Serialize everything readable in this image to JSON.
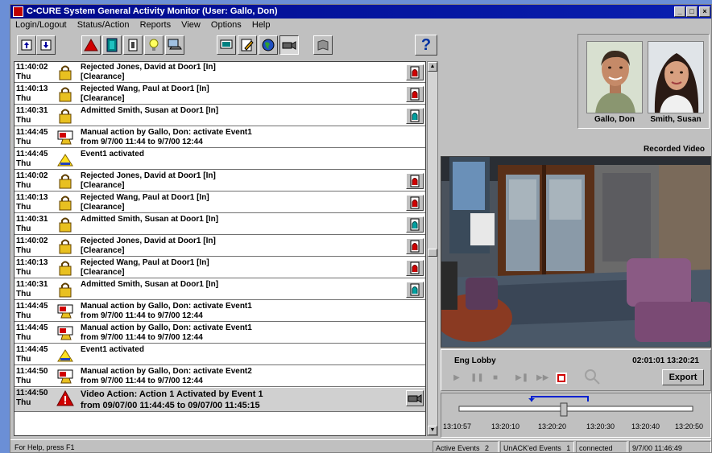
{
  "window": {
    "title": "C•CURE System General Activity Monitor (User: Gallo, Don)"
  },
  "menu": [
    "Login/Logout",
    "Status/Action",
    "Reports",
    "View",
    "Options",
    "Help"
  ],
  "events": [
    {
      "time": "11:40:02",
      "day": "Thu",
      "line1": "Rejected Jones, David at Door1 [In]",
      "line2": "[Clearance]",
      "icon": "lock-icon",
      "action": "door-icon",
      "style": "red"
    },
    {
      "time": "11:40:13",
      "day": "Thu",
      "line1": "Rejected Wang, Paul at Door1 [In]",
      "line2": "[Clearance]",
      "icon": "lock-icon",
      "action": "door-icon",
      "style": "red"
    },
    {
      "time": "11:40:31",
      "day": "Thu",
      "line1": "Admitted Smith, Susan at Door1 [In]",
      "line2": "",
      "icon": "lock-icon",
      "action": "door-icon",
      "style": "teal"
    },
    {
      "time": "11:44:45",
      "day": "Thu",
      "line1": "Manual action by Gallo, Don: activate Event1",
      "line2": "from 9/7/00 11:44 to 9/7/00 12:44",
      "icon": "manual-action-icon",
      "action": "",
      "style": ""
    },
    {
      "time": "11:44:45",
      "day": "Thu",
      "line1": "Event1 activated",
      "line2": "",
      "icon": "event-icon",
      "action": "",
      "style": ""
    },
    {
      "time": "11:40:02",
      "day": "Thu",
      "line1": "Rejected Jones, David at Door1 [In]",
      "line2": "[Clearance]",
      "icon": "lock-icon",
      "action": "door-icon",
      "style": "red"
    },
    {
      "time": "11:40:13",
      "day": "Thu",
      "line1": "Rejected Wang, Paul at Door1 [In]",
      "line2": "[Clearance]",
      "icon": "lock-icon",
      "action": "door-icon",
      "style": "red"
    },
    {
      "time": "11:40:31",
      "day": "Thu",
      "line1": "Admitted Smith, Susan at Door1 [In]",
      "line2": "",
      "icon": "lock-icon",
      "action": "door-icon",
      "style": "teal"
    },
    {
      "time": "11:40:02",
      "day": "Thu",
      "line1": "Rejected Jones, David at Door1 [In]",
      "line2": "[Clearance]",
      "icon": "lock-icon",
      "action": "door-icon",
      "style": "red"
    },
    {
      "time": "11:40:13",
      "day": "Thu",
      "line1": "Rejected Wang, Paul at Door1 [In]",
      "line2": "[Clearance]",
      "icon": "lock-icon",
      "action": "door-icon",
      "style": "red"
    },
    {
      "time": "11:40:31",
      "day": "Thu",
      "line1": "Admitted Smith, Susan at Door1 [In]",
      "line2": "",
      "icon": "lock-icon",
      "action": "door-icon",
      "style": "teal"
    },
    {
      "time": "11:44:45",
      "day": "Thu",
      "line1": "Manual action by Gallo, Don: activate Event1",
      "line2": "from 9/7/00 11:44 to 9/7/00 12:44",
      "icon": "manual-action-icon",
      "action": "",
      "style": ""
    },
    {
      "time": "11:44:45",
      "day": "Thu",
      "line1": "Manual action by Gallo, Don: activate Event1",
      "line2": "from 9/7/00 11:44 to 9/7/00 12:44",
      "icon": "manual-action-icon",
      "action": "",
      "style": ""
    },
    {
      "time": "11:44:45",
      "day": "Thu",
      "line1": "Event1 activated",
      "line2": "",
      "icon": "event-icon",
      "action": "",
      "style": ""
    },
    {
      "time": "11:44:50",
      "day": "Thu",
      "line1": "Manual action by Gallo, Don: activate Event2",
      "line2": "from 9/7/00 11:44 to 9/7/00 12:44",
      "icon": "manual-action-icon",
      "action": "",
      "style": ""
    },
    {
      "time": "11:44:50",
      "day": "Thu",
      "line1": "Video Action: Action 1 Activated by Event 1",
      "line2": "from 09/07/00 11:44:45 to 09/07/00 11:45:15",
      "icon": "alarm-icon",
      "action": "video-icon",
      "style": "big"
    }
  ],
  "photos": [
    {
      "name": "Gallo, Don"
    },
    {
      "name": "Smith, Susan"
    }
  ],
  "video": {
    "label": "Recorded Video",
    "camera": "Eng Lobby",
    "timestamp": "02:01:01 13:20:21",
    "export_label": "Export",
    "ticks": [
      "13:10:57",
      "13:20:10",
      "13:20:20",
      "13:20:30",
      "13:20:40",
      "13:20:50"
    ]
  },
  "status": {
    "help": "For Help, press F1",
    "active_events": "Active Events",
    "active_events_count": "2",
    "unack_events": "UnACK'ed Events",
    "unack_events_count": "1",
    "connection": "connected",
    "datetime": "9/7/00 11:46:49"
  }
}
